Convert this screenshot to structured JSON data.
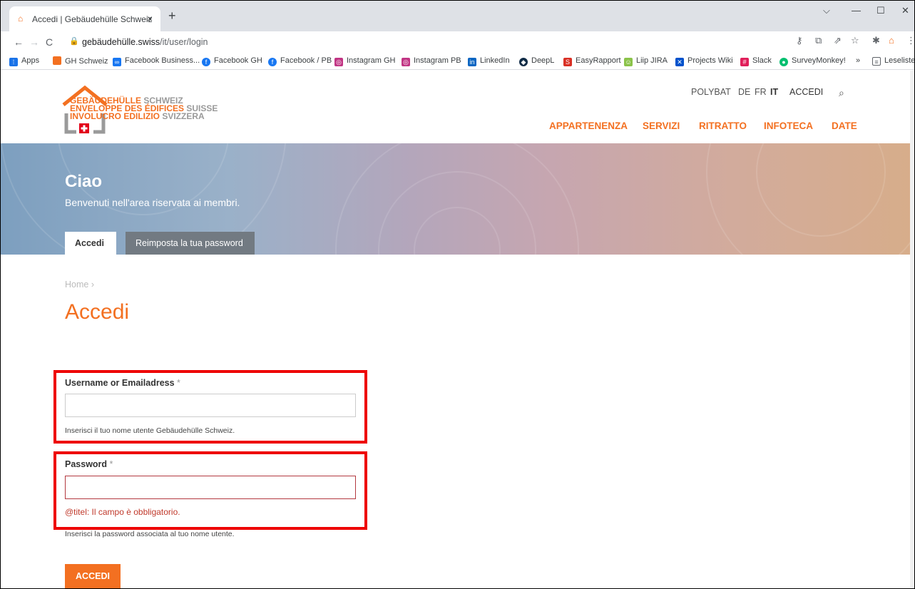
{
  "browser": {
    "tab_title": "Accedi | Gebäudehülle Schweiz",
    "tab_close": "×",
    "new_tab": "+",
    "url_host": "gebäudehülle.swiss",
    "url_path": "/it/user/login",
    "bookmarks": [
      {
        "label": "Apps",
        "color": "#1a73e8"
      },
      {
        "label": "GH Schweiz",
        "color": "#f37021"
      },
      {
        "label": "Facebook Business...",
        "color": "#1877f2"
      },
      {
        "label": "Facebook GH",
        "color": "#1877f2"
      },
      {
        "label": "Facebook / PB",
        "color": "#1877f2"
      },
      {
        "label": "Instagram GH",
        "color": "#c13584"
      },
      {
        "label": "Instagram PB",
        "color": "#c13584"
      },
      {
        "label": "LinkedIn",
        "color": "#0a66c2"
      },
      {
        "label": "DeepL",
        "color": "#0f2b46"
      },
      {
        "label": "EasyRapport",
        "color": "#d93025"
      },
      {
        "label": "Liip JIRA",
        "color": "#8bc34a"
      },
      {
        "label": "Projects Wiki",
        "color": "#0052cc"
      },
      {
        "label": "Slack",
        "color": "#e01e5a"
      },
      {
        "label": "SurveyMonkey!",
        "color": "#00bf6f"
      },
      {
        "label": "Leseliste",
        "color": "#5f6368"
      }
    ],
    "more_bookmarks": "»"
  },
  "site": {
    "logo_lines": [
      {
        "strong": "GEBÄUDEHÜLLE",
        "rest": "SCHWEIZ"
      },
      {
        "strong": "ENVELOPPE DES ÉDIFICES",
        "rest": "SUISSE"
      },
      {
        "strong": "INVOLUCRO EDILIZIO",
        "rest": "SVIZZERA"
      }
    ],
    "top_menu": {
      "polybat": "POLYBAT",
      "lang_de": "DE",
      "lang_fr": "FR",
      "lang_it": "IT",
      "login": "ACCEDI"
    },
    "main_menu": [
      "APPARTENENZA",
      "SERVIZI",
      "RITRATTO",
      "INFOTECA",
      "DATE"
    ]
  },
  "hero": {
    "title": "Ciao",
    "subtitle": "Benvenuti nell'area riservata ai membri.",
    "tabs": [
      "Accedi",
      "Reimposta la tua password"
    ]
  },
  "content": {
    "breadcrumb": "Home ›",
    "title": "Accedi",
    "username": {
      "label": "Username or Emailadress",
      "required": "*",
      "value": "",
      "hint": "Inserisci il tuo nome utente Gebäudehülle Schweiz."
    },
    "password": {
      "label": "Password",
      "required": "*",
      "value": "",
      "error": "@titel: Il campo è obbligatorio.",
      "hint": "Inserisci la password associata al tuo nome utente."
    },
    "submit_label": "ACCEDI"
  },
  "colors": {
    "accent": "#f37021",
    "error_outline": "#ee0000",
    "error_text": "#c0392b"
  }
}
